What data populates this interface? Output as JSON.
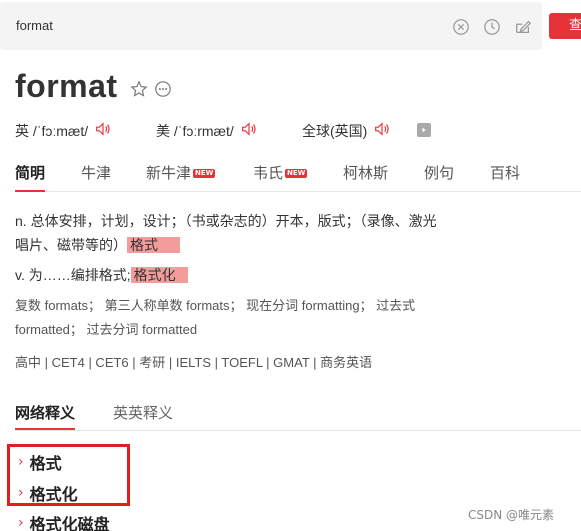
{
  "search": {
    "value": "format",
    "button_label": "查"
  },
  "entry": {
    "word": "format",
    "pron_uk_label": "英 /ˈfɔːmæt/",
    "pron_us_label": "美 /ˈfɔːrmæt/",
    "pron_global_label": "全球(英国)"
  },
  "tabs": [
    {
      "label": "简明"
    },
    {
      "label": "牛津"
    },
    {
      "label": "新牛津",
      "badge": "NEW"
    },
    {
      "label": "韦氏",
      "badge": "NEW"
    },
    {
      "label": "柯林斯"
    },
    {
      "label": "例句"
    },
    {
      "label": "百科"
    }
  ],
  "definitions": {
    "noun_line1": "n. 总体安排，计划，设计；（书或杂志的）开本，版式；（录像、激光",
    "noun_line2": "唱片、磁带等的）",
    "noun_highlight": "格式",
    "verb_prefix": "v. 为……编排格式;",
    "verb_highlight": "格式化"
  },
  "forms": {
    "line1": "复数 formats；  第三人称单数 formats；  现在分词 formatting；  过去式",
    "line2": "formatted；  过去分词 formatted"
  },
  "exams": "高中 | CET4 | CET6 | 考研 | IELTS | TOEFL | GMAT | 商务英语",
  "web_tabs": [
    {
      "label": "网络释义"
    },
    {
      "label": "英英释义"
    }
  ],
  "web_defs": [
    {
      "label": "格式"
    },
    {
      "label": "格式化"
    },
    {
      "label": "格式化磁盘"
    }
  ],
  "watermark": "CSDN @唯元素",
  "colors": {
    "accent": "#e8323a",
    "highlight": "#f49b9b",
    "annotation_box": "#e02020"
  }
}
